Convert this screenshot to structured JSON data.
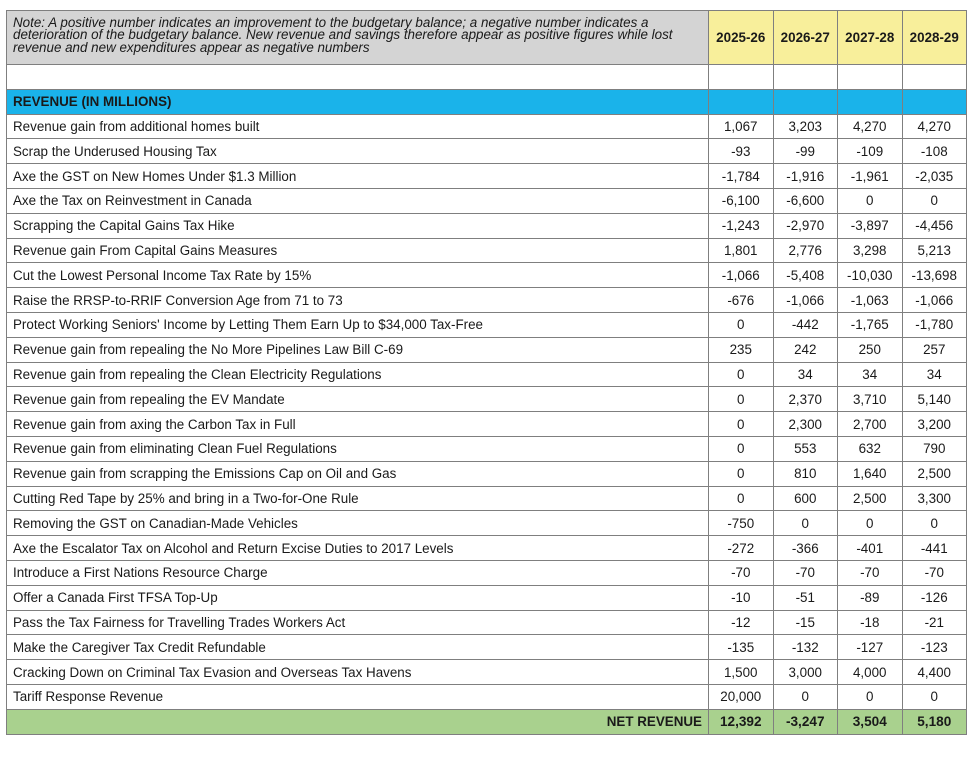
{
  "note": "Note: A positive number indicates an improvement to the budgetary balance; a negative number indicates a deterioration of the budgetary balance. New revenue and savings therefore appear as positive figures while lost revenue and new expenditures appear as negative numbers",
  "years": [
    "2025-26",
    "2026-27",
    "2027-28",
    "2028-29"
  ],
  "section_title": "REVENUE (IN MILLIONS)",
  "rows": [
    {
      "label": "Revenue gain from additional homes built",
      "values": [
        "1,067",
        "3,203",
        "4,270",
        "4,270"
      ]
    },
    {
      "label": "Scrap the Underused Housing Tax",
      "values": [
        "-93",
        "-99",
        "-109",
        "-108"
      ]
    },
    {
      "label": "Axe the GST on New Homes Under $1.3 Million",
      "values": [
        "-1,784",
        "-1,916",
        "-1,961",
        "-2,035"
      ]
    },
    {
      "label": "Axe the Tax on Reinvestment in Canada",
      "values": [
        "-6,100",
        "-6,600",
        "0",
        "0"
      ]
    },
    {
      "label": "Scrapping the Capital Gains Tax Hike",
      "values": [
        "-1,243",
        "-2,970",
        "-3,897",
        "-4,456"
      ]
    },
    {
      "label": "Revenue gain From Capital Gains Measures",
      "values": [
        "1,801",
        "2,776",
        "3,298",
        "5,213"
      ]
    },
    {
      "label": "Cut the Lowest Personal Income Tax Rate by 15%",
      "values": [
        "-1,066",
        "-5,408",
        "-10,030",
        "-13,698"
      ]
    },
    {
      "label": "Raise the RRSP-to-RRIF Conversion Age from 71 to 73",
      "values": [
        "-676",
        "-1,066",
        "-1,063",
        "-1,066"
      ]
    },
    {
      "label": "Protect Working Seniors' Income by Letting Them Earn Up to $34,000 Tax-Free",
      "values": [
        "0",
        "-442",
        "-1,765",
        "-1,780"
      ]
    },
    {
      "label": "Revenue gain from repealing the No More Pipelines Law Bill C-69",
      "values": [
        "235",
        "242",
        "250",
        "257"
      ]
    },
    {
      "label": "Revenue gain from repealing the Clean Electricity Regulations",
      "values": [
        "0",
        "34",
        "34",
        "34"
      ]
    },
    {
      "label": "Revenue gain from repealing the EV Mandate",
      "values": [
        "0",
        "2,370",
        "3,710",
        "5,140"
      ]
    },
    {
      "label": "Revenue gain from axing the Carbon Tax in Full",
      "values": [
        "0",
        "2,300",
        "2,700",
        "3,200"
      ]
    },
    {
      "label": "Revenue gain from eliminating Clean Fuel Regulations",
      "values": [
        "0",
        "553",
        "632",
        "790"
      ]
    },
    {
      "label": "Revenue gain from scrapping the Emissions Cap on Oil and Gas",
      "values": [
        "0",
        "810",
        "1,640",
        "2,500"
      ]
    },
    {
      "label": "Cutting Red Tape by 25% and bring in a Two-for-One Rule",
      "values": [
        "0",
        "600",
        "2,500",
        "3,300"
      ]
    },
    {
      "label": "Removing the GST on Canadian-Made Vehicles",
      "values": [
        "-750",
        "0",
        "0",
        "0"
      ]
    },
    {
      "label": "Axe the Escalator Tax on Alcohol and Return Excise Duties to 2017 Levels",
      "values": [
        "-272",
        "-366",
        "-401",
        "-441"
      ]
    },
    {
      "label": "Introduce a First Nations Resource Charge",
      "values": [
        "-70",
        "-70",
        "-70",
        "-70"
      ]
    },
    {
      "label": "Offer a Canada First TFSA Top-Up",
      "values": [
        "-10",
        "-51",
        "-89",
        "-126"
      ]
    },
    {
      "label": "Pass the Tax Fairness for Travelling Trades Workers Act",
      "values": [
        "-12",
        "-15",
        "-18",
        "-21"
      ]
    },
    {
      "label": "Make the Caregiver Tax Credit Refundable",
      "values": [
        "-135",
        "-132",
        "-127",
        "-123"
      ]
    },
    {
      "label": "Cracking Down on Criminal Tax Evasion and Overseas Tax Havens",
      "values": [
        "1,500",
        "3,000",
        "4,000",
        "4,400"
      ]
    },
    {
      "label": "Tariff Response Revenue",
      "values": [
        "20,000",
        "0",
        "0",
        "0"
      ]
    }
  ],
  "total": {
    "label": "NET REVENUE",
    "values": [
      "12,392",
      "-3,247",
      "3,504",
      "5,180"
    ]
  },
  "colors": {
    "note_bg": "#d4d4d4",
    "year_header_bg": "#f8ef9b",
    "section_bg": "#1ab3ea",
    "total_bg": "#a9d18e",
    "grid": "#7f7f7f"
  }
}
